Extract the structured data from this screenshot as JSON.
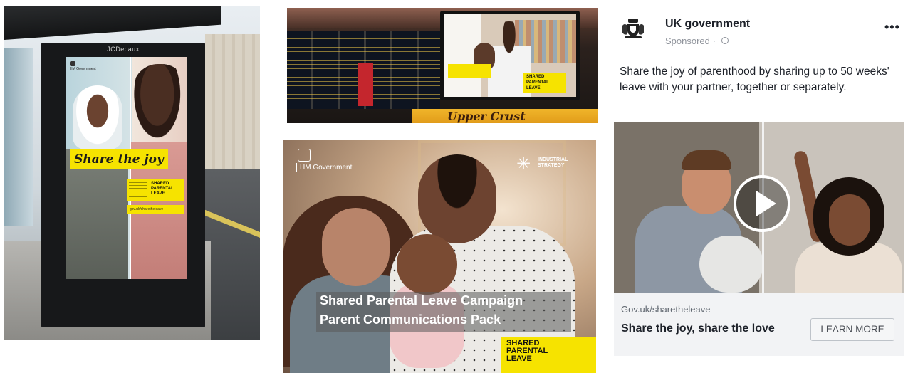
{
  "bus_shelter": {
    "brand": "JCDecaux",
    "poster_gov": "HM Government",
    "poster_headline": "Share the joy",
    "poster_badge": "SHARED\nPARENTAL\nLEAVE",
    "poster_url": "gov.uk/sharetheleave"
  },
  "station": {
    "screen_badge": "SHARED\nPARENTAL\nLEAVE",
    "shop_sign": "Upper Crust"
  },
  "campaign_pack": {
    "gov_label": "HM Government",
    "partner_label": "INDUSTRIAL\nSTRATEGY",
    "title_line1": "Shared Parental Leave Campaign",
    "title_line2": "Parent Communications Pack",
    "badge": "SHARED\nPARENTAL\nLEAVE"
  },
  "facebook_ad": {
    "page_name": "UK government",
    "sponsored": "Sponsored · ",
    "more": "•••",
    "copy": "Share the joy of parenthood by sharing up to 50 weeks' leave with your partner, together or separately.",
    "domain": "Gov.uk/sharetheleave",
    "headline": "Share the joy, share the love",
    "cta": "LEARN MORE"
  },
  "icons": [
    "crest-icon",
    "globe-icon",
    "more-options-icon",
    "play-icon",
    "industrial-strategy-star-icon"
  ],
  "colors": {
    "campaign_yellow": "#f6e300",
    "fb_text": "#1d2129",
    "fb_grey": "#90949c"
  }
}
